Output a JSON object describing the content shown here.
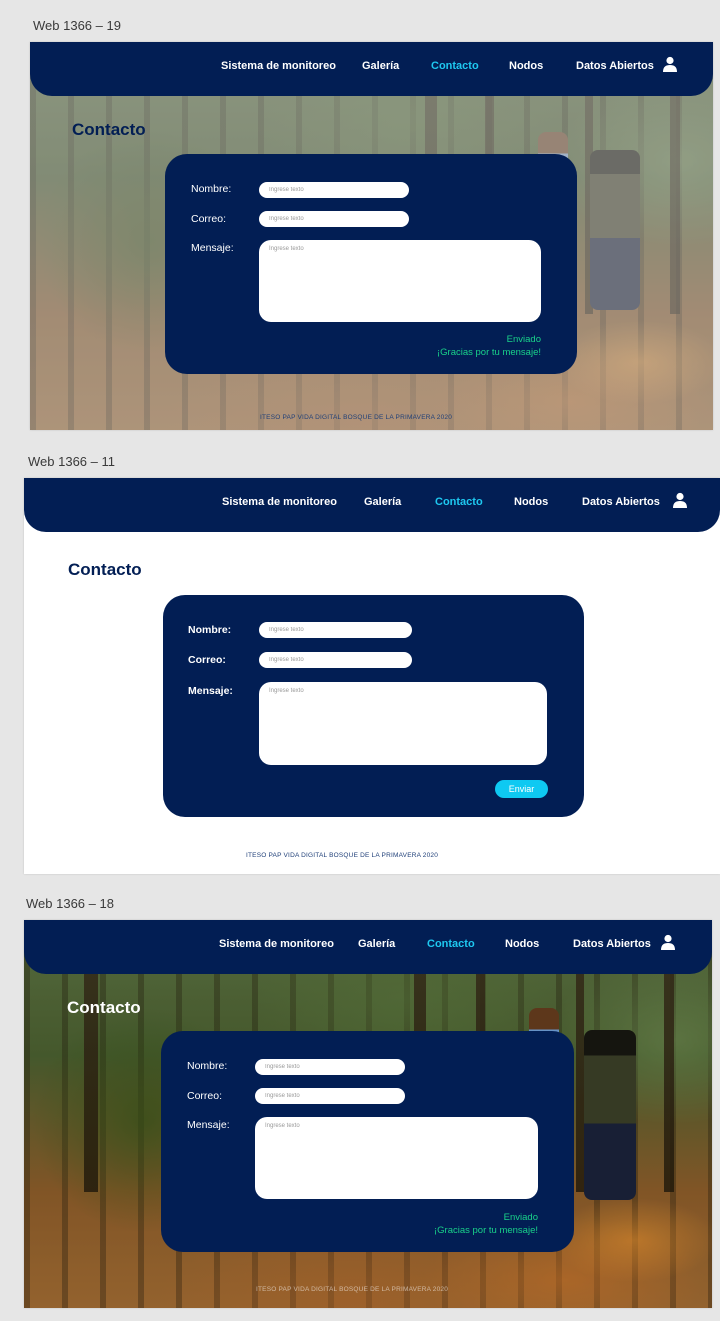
{
  "frames": [
    {
      "label": "Web 1366 – 19",
      "nav": {
        "items": [
          "Sistema de monitoreo",
          "Galería",
          "Contacto",
          "Nodos",
          "Datos Abiertos"
        ],
        "active": "Contacto",
        "user_icon": "user-icon"
      },
      "title": "Contacto",
      "form": {
        "name_label": "Nombre:",
        "name_placeholder": "Ingrese texto",
        "email_label": "Correo:",
        "email_placeholder": "Ingrese texto",
        "message_label": "Mensaje:",
        "message_placeholder": "Ingrese texto",
        "status_line1": "Enviado",
        "status_line2": "¡Gracias por tu mensaje!"
      },
      "footer": "ITESO PAP VIDA DIGITAL BOSQUE DE LA PRIMAVERA 2020"
    },
    {
      "label": "Web 1366 – 11",
      "nav": {
        "items": [
          "Sistema de monitoreo",
          "Galería",
          "Contacto",
          "Nodos",
          "Datos Abiertos"
        ],
        "active": "Contacto",
        "user_icon": "user-icon"
      },
      "title": "Contacto",
      "form": {
        "name_label": "Nombre:",
        "name_placeholder": "Ingrese texto",
        "email_label": "Correo:",
        "email_placeholder": "Ingrese texto",
        "message_label": "Mensaje:",
        "message_placeholder": "Ingrese texto",
        "submit_label": "Enviar"
      },
      "footer": "ITESO PAP VIDA DIGITAL BOSQUE DE LA PRIMAVERA 2020"
    },
    {
      "label": "Web 1366 – 18",
      "nav": {
        "items": [
          "Sistema de monitoreo",
          "Galería",
          "Contacto",
          "Nodos",
          "Datos Abiertos"
        ],
        "active": "Contacto",
        "user_icon": "user-icon"
      },
      "title": "Contacto",
      "form": {
        "name_label": "Nombre:",
        "name_placeholder": "Ingrese texto",
        "email_label": "Correo:",
        "email_placeholder": "Ingrese texto",
        "message_label": "Mensaje:",
        "message_placeholder": "Ingrese texto",
        "status_line1": "Enviado",
        "status_line2": "¡Gracias por tu mensaje!"
      },
      "footer": "ITESO PAP VIDA DIGITAL BOSQUE DE LA PRIMAVERA 2020"
    }
  ],
  "colors": {
    "navy": "#021e54",
    "accent": "#1ec8f0",
    "success": "#19d28a",
    "button": "#0ec9f2",
    "canvas": "#e6e6e6"
  }
}
